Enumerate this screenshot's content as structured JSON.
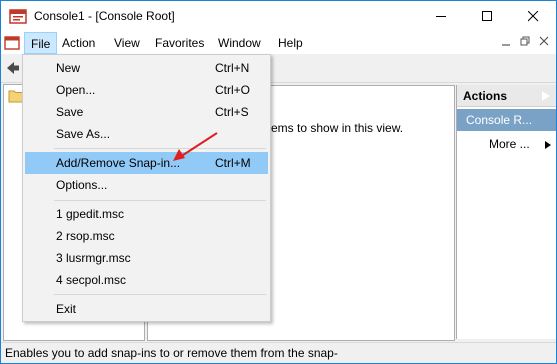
{
  "window": {
    "title": "Console1 - [Console Root]"
  },
  "menubar": {
    "items": [
      "File",
      "Action",
      "View",
      "Favorites",
      "Window",
      "Help"
    ]
  },
  "file_menu": {
    "items": [
      {
        "label": "New",
        "shortcut": "Ctrl+N"
      },
      {
        "label": "Open...",
        "shortcut": "Ctrl+O"
      },
      {
        "label": "Save",
        "shortcut": "Ctrl+S"
      },
      {
        "label": "Save As...",
        "shortcut": ""
      },
      {
        "label": "Add/Remove Snap-in...",
        "shortcut": "Ctrl+M",
        "highlighted": true
      },
      {
        "label": "Options...",
        "shortcut": ""
      },
      {
        "label": "1 gpedit.msc",
        "shortcut": ""
      },
      {
        "label": "2 rsop.msc",
        "shortcut": ""
      },
      {
        "label": "3 lusrmgr.msc",
        "shortcut": ""
      },
      {
        "label": "4 secpol.msc",
        "shortcut": ""
      },
      {
        "label": "Exit",
        "shortcut": ""
      }
    ]
  },
  "center": {
    "message": "ems to show in this view."
  },
  "actions": {
    "header": "Actions",
    "console_item": "Console R...",
    "more": "More ..."
  },
  "status": {
    "text": "Enables you to add snap-ins to or remove them from the snap-"
  },
  "colors": {
    "accent": "#1883d7",
    "highlight": "#91c9f7",
    "actions_selected": "#7aa2c6",
    "annotation_arrow": "#e02020"
  },
  "icons": [
    "mmc-console-icon",
    "minimize-icon",
    "maximize-icon",
    "close-icon",
    "back-arrow-icon",
    "folder-icon",
    "red-annotation-arrow"
  ]
}
